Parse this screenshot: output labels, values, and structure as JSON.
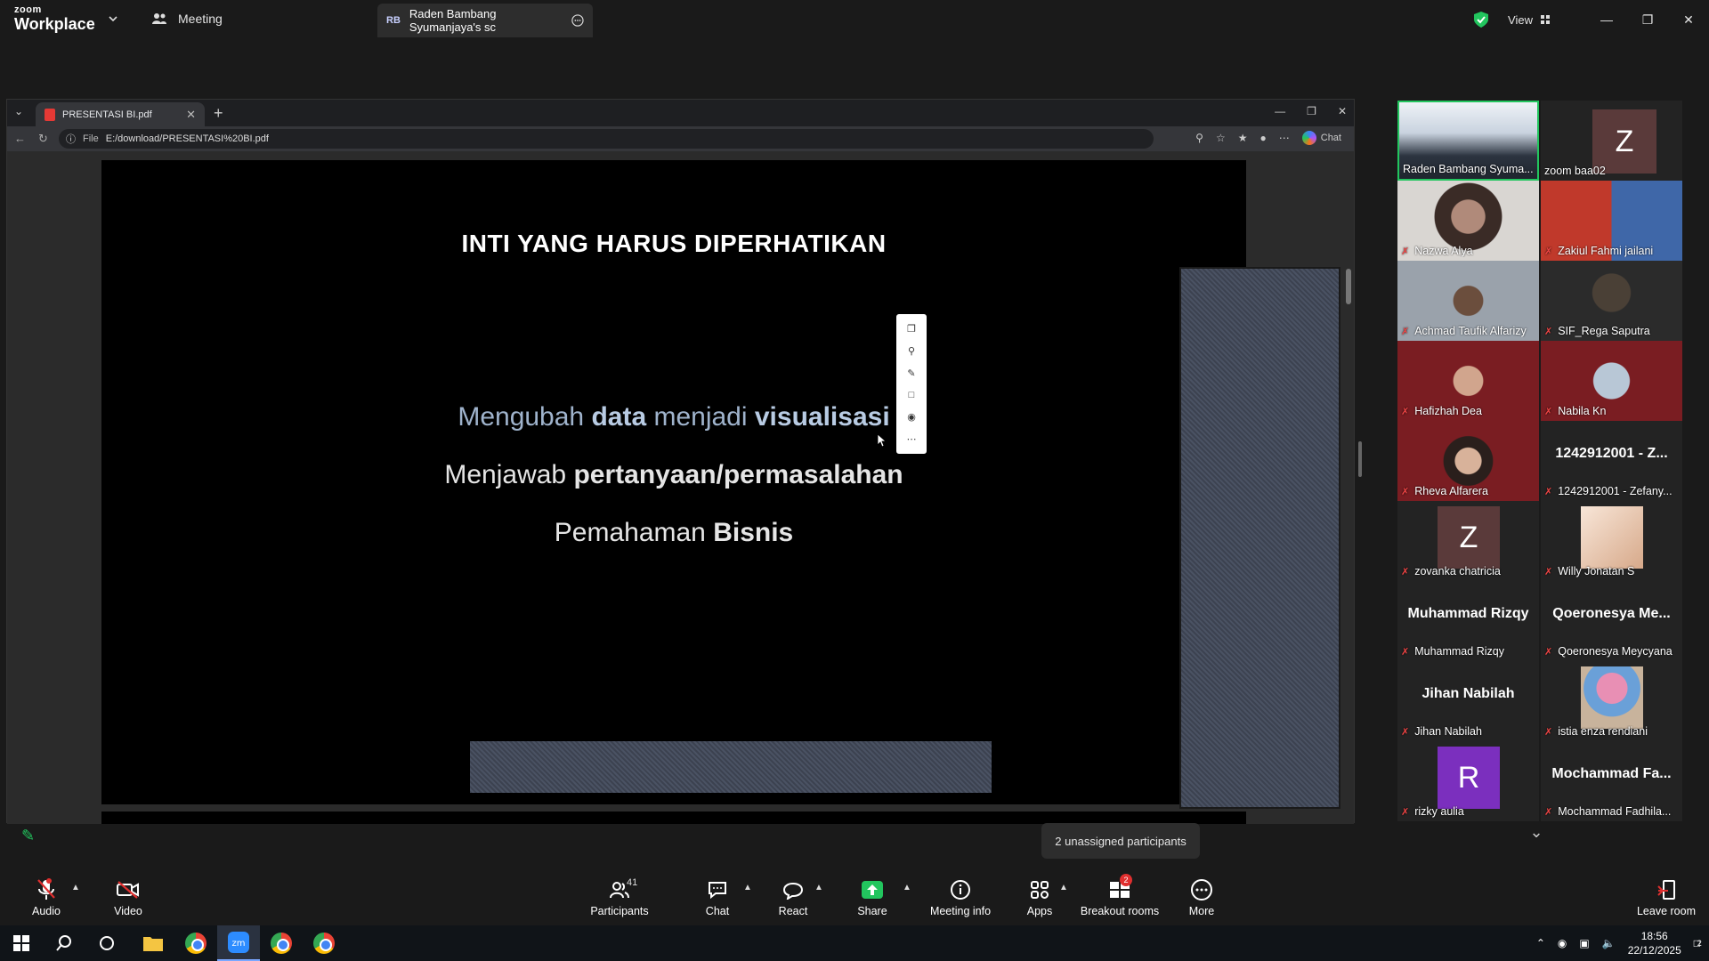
{
  "zoom": {
    "logo_line1": "zoom",
    "logo_line2": "Workplace",
    "meeting_label": "Meeting",
    "share_tab": {
      "initials": "RB",
      "label": "Raden Bambang Syumanjaya's sc"
    },
    "view_label": "View"
  },
  "browser": {
    "tab_title": "PRESENTASI BI.pdf",
    "address_prefix": "File",
    "address": "E:/download/PRESENTASI%20BI.pdf",
    "copilot_label": "Chat"
  },
  "slide": {
    "title": "INTI YANG HARUS DIPERHATIKAN",
    "line1": {
      "a": "Mengubah ",
      "b": "data",
      "c": " menjadi ",
      "d": "visualisasi"
    },
    "line2": {
      "a": "Menjawab ",
      "b": "pertanyaan/permasalahan"
    },
    "line3": {
      "a": "Pemahaman ",
      "b": "Bisnis"
    }
  },
  "gallery": [
    {
      "name": "Raden Bambang Syuma...",
      "muted": false,
      "type": "video",
      "active": true
    },
    {
      "name": "zoom baa02",
      "muted": false,
      "type": "avatar",
      "letter": "Z",
      "color": "#5a3a3a"
    },
    {
      "name": "Nazwa Alya",
      "muted": true,
      "type": "video"
    },
    {
      "name": "Zakiul Fahmi jailani",
      "muted": true,
      "type": "video"
    },
    {
      "name": "Achmad Taufik Alfarizy",
      "muted": true,
      "type": "video"
    },
    {
      "name": "SIF_Rega Saputra",
      "muted": true,
      "type": "video"
    },
    {
      "name": "Hafizhah Dea",
      "muted": true,
      "type": "video"
    },
    {
      "name": "Nabila Kn",
      "muted": true,
      "type": "video"
    },
    {
      "name": "Rheva Alfarera",
      "muted": true,
      "type": "video"
    },
    {
      "name": "1242912001 - Zefany...",
      "muted": true,
      "type": "name",
      "big": "1242912001 - Z..."
    },
    {
      "name": "zovanka chatricia",
      "muted": true,
      "type": "avatar",
      "letter": "Z",
      "color": "#5a3a3a"
    },
    {
      "name": "Willy Jonatan S",
      "muted": true,
      "type": "photo"
    },
    {
      "name": "Muhammad Rizqy",
      "muted": true,
      "type": "name",
      "big": "Muhammad Rizqy"
    },
    {
      "name": "Qoeronesya Meycyana",
      "muted": true,
      "type": "name",
      "big": "Qoeronesya Me..."
    },
    {
      "name": "Jihan Nabilah",
      "muted": true,
      "type": "name",
      "big": "Jihan Nabilah"
    },
    {
      "name": "istia enza rendiani",
      "muted": true,
      "type": "photo"
    },
    {
      "name": "rizky aulia",
      "muted": true,
      "type": "avatar",
      "letter": "R",
      "color": "#7b2fbe"
    },
    {
      "name": "Mochammad Fadhila...",
      "muted": true,
      "type": "name",
      "big": "Mochammad Fa..."
    }
  ],
  "toast": "2 unassigned participants",
  "toolbar": {
    "audio": "Audio",
    "video": "Video",
    "participants": "Participants",
    "participants_count": "41",
    "chat": "Chat",
    "react": "React",
    "share": "Share",
    "meeting_info": "Meeting info",
    "apps": "Apps",
    "breakout": "Breakout rooms",
    "breakout_badge": "2",
    "more": "More",
    "leave": "Leave room"
  },
  "taskbar": {
    "time": "18:56",
    "date": "22/12/2025",
    "notif_count": "2"
  },
  "colors": {
    "accent_green": "#22c55e",
    "mute_red": "#ef4444",
    "leave_red": "#e02f2f"
  }
}
